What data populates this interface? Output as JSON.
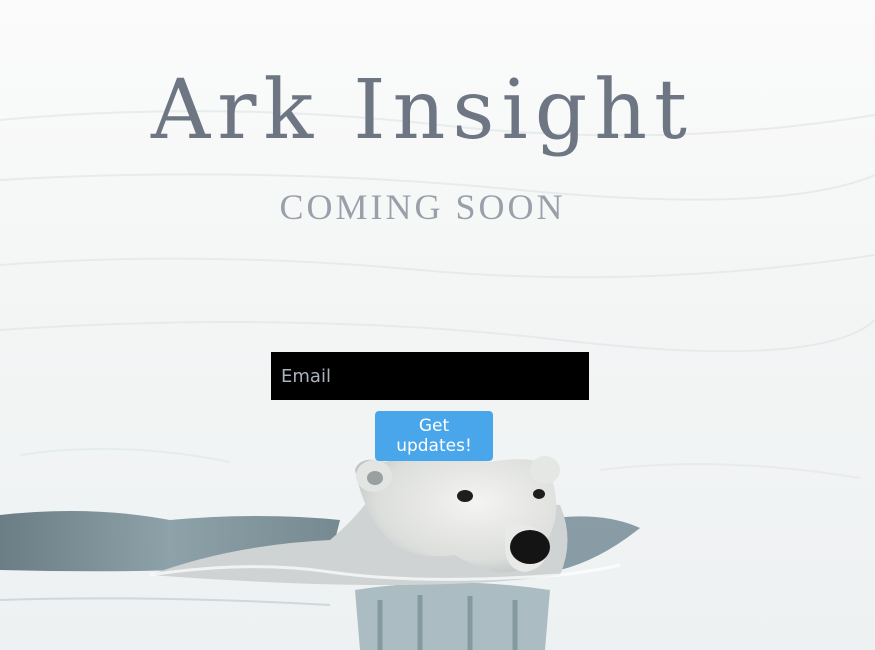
{
  "hero": {
    "title": "Ark Insight",
    "subtitle": "COMING SOON",
    "background_image": "polar-bear-swimming-in-water"
  },
  "signup": {
    "email_placeholder": "Email",
    "email_value": "",
    "submit_label": "Get updates!"
  },
  "colors": {
    "title": "#6e7583",
    "subtitle": "#9aa0aa",
    "input_background": "#000000",
    "button": "#4aa6ea",
    "button_text": "#ffffff"
  }
}
